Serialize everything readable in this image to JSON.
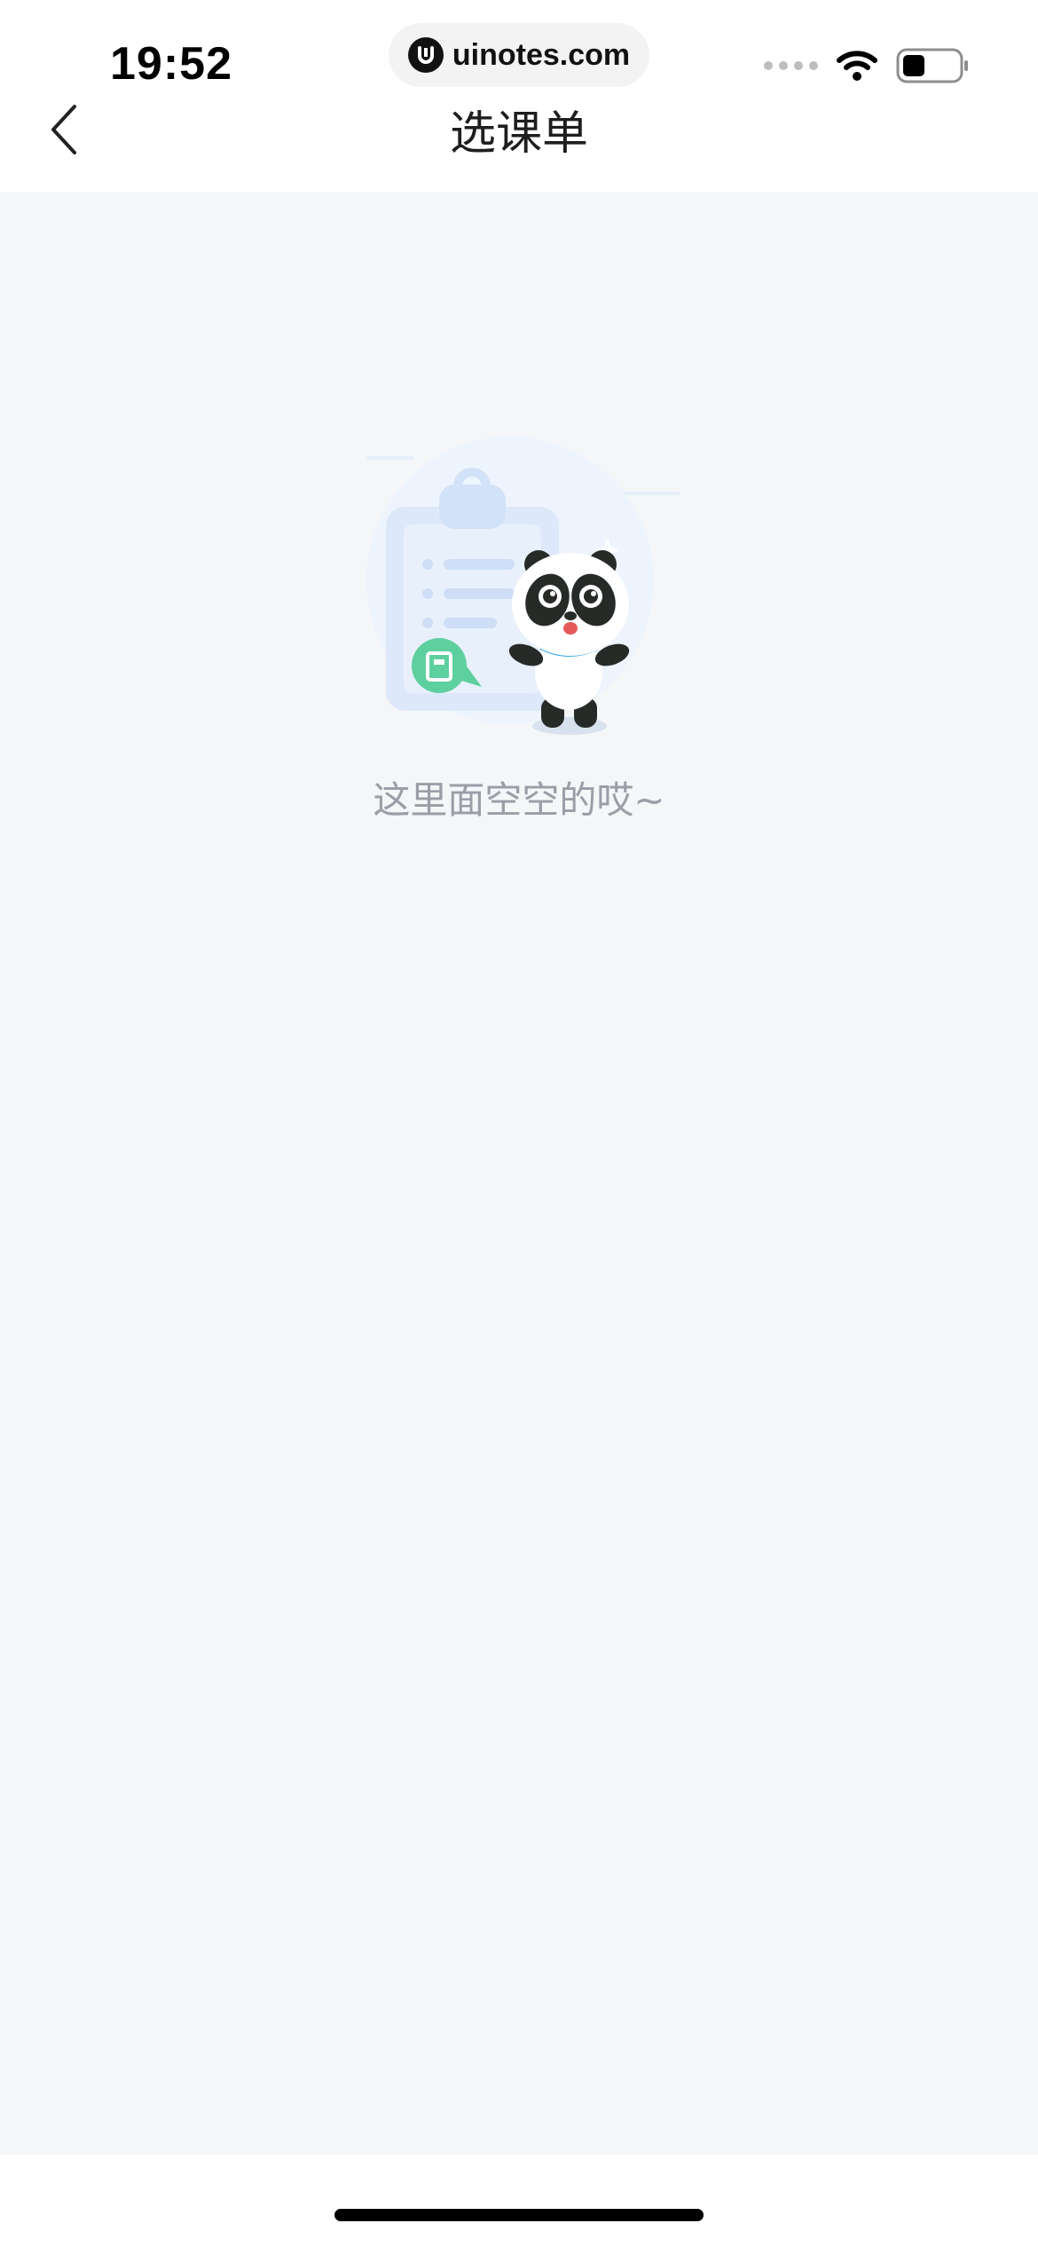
{
  "status_bar": {
    "time": "19:52",
    "url": "uinotes.com"
  },
  "nav": {
    "title": "选课单",
    "back_icon": "chevron-left-icon"
  },
  "empty_state": {
    "message": "这里面空空的哎~",
    "illustration": "panda-clipboard-illustration"
  },
  "colors": {
    "content_background": "#f5f6f8",
    "empty_text": "#9a9ea6",
    "accent_green": "#5ecf9e",
    "accent_blue": "#3aa8e8"
  }
}
